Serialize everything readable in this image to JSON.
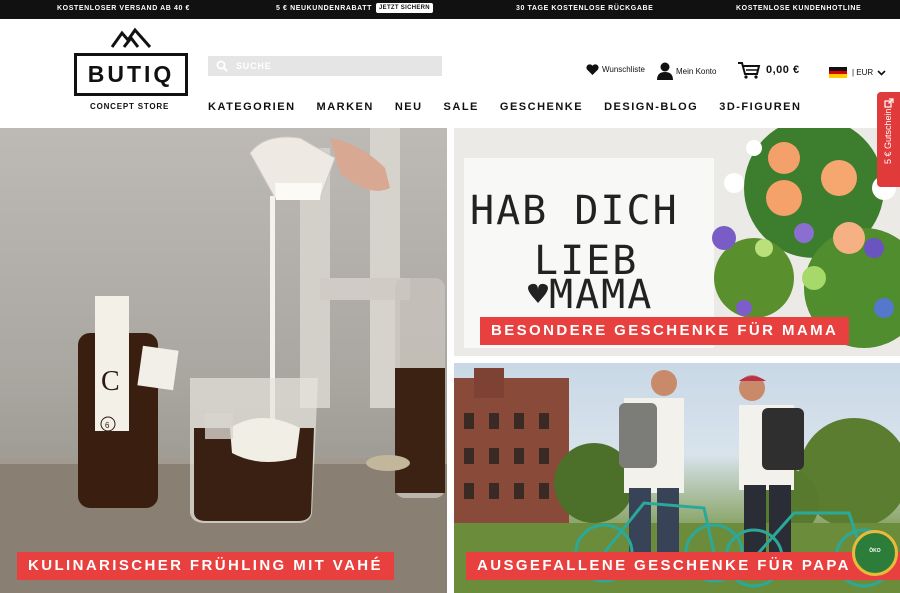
{
  "topbar": {
    "free_shipping": "Kostenloser Versand ab 40 €",
    "discount": "5 € Neukundenrabatt",
    "discount_cta": "Jetzt sichern",
    "returns": "30 Tage kostenlose Rückgabe",
    "hotline": "Kostenlose Kundenhotline"
  },
  "logo": {
    "name": "BUTIQ",
    "tagline": "CONCEPT STORE"
  },
  "search": {
    "placeholder": "SUCHE",
    "value": ""
  },
  "utility": {
    "wishlist": "Wunschliste",
    "account": "Mein Konto",
    "cart_total": "0,00 €",
    "currency": "| EUR"
  },
  "nav": [
    "Kategorien",
    "Marken",
    "Neu",
    "Sale",
    "Geschenke",
    "Design-Blog",
    "3D-Figuren"
  ],
  "voucher_tab": "5 € Gutschein",
  "banners": {
    "left": "Kulinarischer Frühling mit Vahé",
    "mama": "Besondere Geschenke für Mama",
    "papa": "Ausgefallene Geschenke für Papa"
  },
  "lightbox_text": [
    "HAB DICH",
    "LIEB",
    "MAMA"
  ],
  "bottle_label": {
    "letter": "C",
    "number": "6"
  },
  "seal_text": "ÖKO",
  "colors": {
    "accent": "#e8403e",
    "topbar_bg": "#111111",
    "search_bg": "#e5e5e5"
  }
}
